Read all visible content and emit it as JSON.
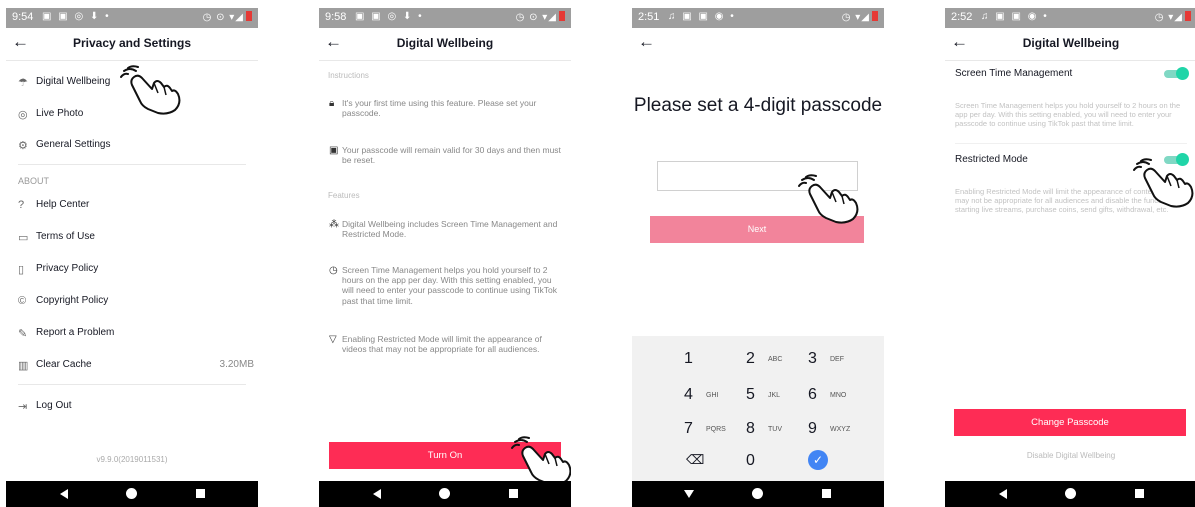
{
  "panel1": {
    "status": {
      "time": "9:54"
    },
    "title": "Privacy and Settings",
    "items": [
      {
        "label": "Digital Wellbeing",
        "icon": "umbrella-icon"
      },
      {
        "label": "Live Photo",
        "icon": "live-photo-icon"
      },
      {
        "label": "General Settings",
        "icon": "gear-icon"
      }
    ],
    "about_header": "ABOUT",
    "about_items": [
      {
        "label": "Help Center",
        "icon": "question-icon"
      },
      {
        "label": "Terms of Use",
        "icon": "document-icon"
      },
      {
        "label": "Privacy Policy",
        "icon": "privacy-doc-icon"
      },
      {
        "label": "Copyright Policy",
        "icon": "copyright-icon"
      },
      {
        "label": "Report a Problem",
        "icon": "pencil-icon"
      },
      {
        "label": "Clear Cache",
        "icon": "trash-icon",
        "value": "3.20MB"
      }
    ],
    "logout": "Log Out",
    "version": "v9.9.0(2019011531)"
  },
  "panel2": {
    "status": {
      "time": "9:58"
    },
    "title": "Digital Wellbeing",
    "instructions_label": "Instructions",
    "instructions": [
      {
        "icon": "lock-icon",
        "text": "It's your first time using this feature. Please set your passcode."
      },
      {
        "icon": "calendar-icon",
        "text": "Your passcode will remain valid for 30 days and then must be reset."
      }
    ],
    "features_label": "Features",
    "features": [
      {
        "icon": "hierarchy-icon",
        "text": "Digital Wellbeing includes Screen Time Management and Restricted Mode."
      },
      {
        "icon": "clock-icon",
        "text": "Screen Time Management helps you hold yourself to 2 hours on the app per day. With this setting enabled, you will need to enter your passcode to continue using TikTok past that time limit."
      },
      {
        "icon": "filter-icon",
        "text": "Enabling Restricted Mode will limit the appearance of videos that may not be appropriate for all audiences."
      }
    ],
    "button": "Turn On"
  },
  "panel3": {
    "status": {
      "time": "2:51"
    },
    "title": "Please set a 4-digit passcode",
    "next": "Next",
    "keys": [
      {
        "n": "1",
        "l": ""
      },
      {
        "n": "2",
        "l": "ABC"
      },
      {
        "n": "3",
        "l": "DEF"
      },
      {
        "n": "4",
        "l": "GHI"
      },
      {
        "n": "5",
        "l": "JKL"
      },
      {
        "n": "6",
        "l": "MNO"
      },
      {
        "n": "7",
        "l": "PQRS"
      },
      {
        "n": "8",
        "l": "TUV"
      },
      {
        "n": "9",
        "l": "WXYZ"
      }
    ],
    "zero": "0",
    "backspace": "⌫",
    "done": "✓"
  },
  "panel4": {
    "status": {
      "time": "2:52"
    },
    "title": "Digital Wellbeing",
    "stm_label": "Screen Time Management",
    "stm_on": true,
    "stm_desc": "Screen Time Management helps you hold yourself to 2 hours on the app per day. With this setting enabled, you will need to enter your passcode to continue using TikTok past that time limit.",
    "rm_label": "Restricted Mode",
    "rm_on": true,
    "rm_desc": "Enabling Restricted Mode will limit the appearance of content that may not be appropriate for all audiences and disable the function of starting live streams, purchase coins, send gifts, withdrawal, etc.",
    "button": "Change Passcode",
    "disable": "Disable Digital Wellbeing"
  },
  "colors": {
    "accent": "#fe2c55",
    "accent_disabled": "#f2849b",
    "toggle": "#20d5a8",
    "statusbar": "#9e9e9e"
  }
}
